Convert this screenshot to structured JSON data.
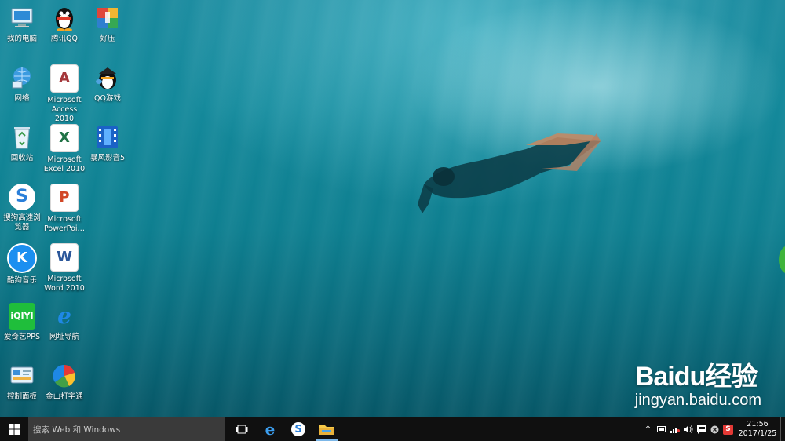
{
  "desktop": {
    "icons": [
      {
        "label": "我的电脑",
        "icon": "computer-icon"
      },
      {
        "label": "腾讯QQ",
        "icon": "qq-penguin-icon"
      },
      {
        "label": "好压",
        "icon": "haozip-icon"
      },
      {
        "label": "网络",
        "icon": "network-icon"
      },
      {
        "label": "Microsoft Access 2010",
        "icon": "access-icon"
      },
      {
        "label": "QQ游戏",
        "icon": "qq-game-icon"
      },
      {
        "label": "回收站",
        "icon": "recycle-bin-icon"
      },
      {
        "label": "Microsoft Excel 2010",
        "icon": "excel-icon"
      },
      {
        "label": "暴风影音5",
        "icon": "baofeng-player-icon"
      },
      {
        "label": "搜狗高速浏览器",
        "icon": "sogou-browser-icon"
      },
      {
        "label": "Microsoft PowerPoi…",
        "icon": "powerpoint-icon"
      },
      {
        "label": "酷狗音乐",
        "icon": "kugou-music-icon"
      },
      {
        "label": "Microsoft Word 2010",
        "icon": "word-icon"
      },
      {
        "label": "爱奇艺PPS",
        "icon": "iqiyi-icon"
      },
      {
        "label": "网址导航",
        "icon": "ie-icon"
      },
      {
        "label": "控制面板",
        "icon": "control-panel-icon"
      },
      {
        "label": "金山打字通",
        "icon": "kingsoft-typing-icon"
      }
    ],
    "watermark": {
      "brand": "Baidu经验",
      "url": "jingyan.baidu.com"
    }
  },
  "taskbar": {
    "search_placeholder": "搜索 Web 和 Windows",
    "apps": [
      "task-view-icon",
      "edge-icon",
      "sogou-browser-icon",
      "file-explorer-icon"
    ],
    "tray": {
      "icons": [
        "chevron-up-icon",
        "battery-icon",
        "network-disconnected-icon",
        "volume-icon",
        "action-center-icon",
        "close-circle-icon",
        "sogou-input-icon"
      ],
      "time": "21:56",
      "date": "2017/1/25"
    }
  }
}
